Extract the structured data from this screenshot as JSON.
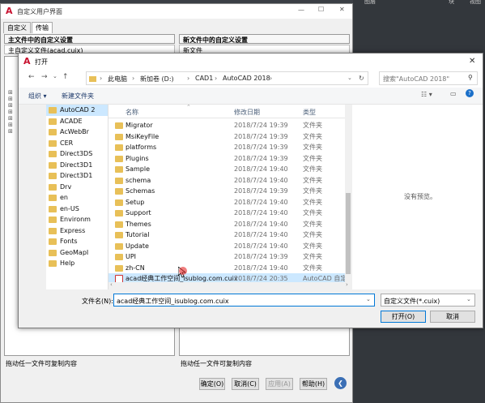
{
  "back_dialog": {
    "title": "自定义用户界面",
    "tabs": [
      "自定义",
      "传输"
    ],
    "main_panel_title": "主文件中的自定义设置",
    "main_panel_sub": "主自定义文件(acad.cuix)",
    "new_panel_title": "新文件中的自定义设置",
    "new_panel_sub": "新文件",
    "hint_left": "拖动任一文件可复制内容",
    "hint_right": "拖动任一文件可复制内容",
    "buttons": {
      "ok": "确定(O)",
      "cancel": "取消(C)",
      "apply": "应用(A)",
      "help": "帮助(H)"
    }
  },
  "open_dialog": {
    "title": "打开",
    "breadcrumb": [
      "此电脑",
      "新加卷 (D:)",
      "CAD1",
      "AutoCAD 2018"
    ],
    "search_placeholder": "搜索\"AutoCAD 2018\"",
    "organize_label": "组织 ▾",
    "new_folder_label": "新建文件夹",
    "left_tree": [
      "AutoCAD 2",
      "ACADE",
      "AcWebBr",
      "CER",
      "Direct3DS",
      "Direct3D1",
      "Direct3D1",
      "Drv",
      "en",
      "en-US",
      "Environm",
      "Express",
      "Fonts",
      "GeoMapI",
      "Help"
    ],
    "columns": {
      "name": "名称",
      "date": "修改日期",
      "type": "类型"
    },
    "files": [
      {
        "name": "Migrator",
        "date": "2018/7/24 19:39",
        "type": "文件夹"
      },
      {
        "name": "MsiKeyFile",
        "date": "2018/7/24 19:39",
        "type": "文件夹"
      },
      {
        "name": "platforms",
        "date": "2018/7/24 19:39",
        "type": "文件夹"
      },
      {
        "name": "Plugins",
        "date": "2018/7/24 19:39",
        "type": "文件夹"
      },
      {
        "name": "Sample",
        "date": "2018/7/24 19:40",
        "type": "文件夹"
      },
      {
        "name": "schema",
        "date": "2018/7/24 19:40",
        "type": "文件夹"
      },
      {
        "name": "Schemas",
        "date": "2018/7/24 19:39",
        "type": "文件夹"
      },
      {
        "name": "Setup",
        "date": "2018/7/24 19:40",
        "type": "文件夹"
      },
      {
        "name": "Support",
        "date": "2018/7/24 19:40",
        "type": "文件夹"
      },
      {
        "name": "Themes",
        "date": "2018/7/24 19:40",
        "type": "文件夹"
      },
      {
        "name": "Tutorial",
        "date": "2018/7/24 19:40",
        "type": "文件夹"
      },
      {
        "name": "Update",
        "date": "2018/7/24 19:40",
        "type": "文件夹"
      },
      {
        "name": "UPI",
        "date": "2018/7/24 19:39",
        "type": "文件夹"
      },
      {
        "name": "zh-CN",
        "date": "2018/7/24 19:40",
        "type": "文件夹"
      },
      {
        "name": "acad经典工作空间_isublog.com.cuix",
        "date": "2018/7/24 20:35",
        "type": "AutoCAD 自定义"
      }
    ],
    "no_preview": "没有预览。",
    "filename_label": "文件名(N):",
    "filename_value": "acad经典工作空间_isublog.com.cuix",
    "filter_value": "自定义文件(*.cuix)",
    "open_button": "打开(O)",
    "cancel_button": "取消"
  },
  "cad_bg": {
    "labels": [
      "图层",
      "块",
      "视图"
    ]
  }
}
